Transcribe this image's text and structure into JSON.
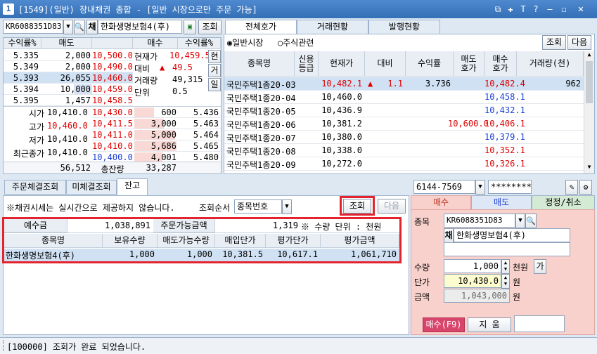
{
  "window": {
    "number": "1",
    "title": "[1549](일반) 장내채권 종합 - [일반 시장으로만 주문 가능]"
  },
  "titlebar_icons": [
    "restore-icon",
    "pin-icon",
    "text-icon",
    "help-icon",
    "minimize-icon",
    "maximize-icon",
    "close-icon"
  ],
  "top_left": {
    "code": "KR6088351D83",
    "type_badge": "채",
    "name": "한화생명보험4(후)",
    "query_button": "조회",
    "orderbook_headers": [
      "수익률%",
      "매도",
      "",
      "매수",
      "수익률%"
    ],
    "ask_rows": [
      {
        "yield": "5.335",
        "qty": "2,000",
        "price": "10,500.0"
      },
      {
        "yield": "5.349",
        "qty": "2,000",
        "price": "10,490.0"
      },
      {
        "yield": "5.393",
        "qty": "26,055",
        "price": "10,460.0"
      },
      {
        "yield": "5.394",
        "qty": "10,000",
        "price": "10,459.0"
      },
      {
        "yield": "5.395",
        "qty": "1,457",
        "price": "10,458.5"
      }
    ],
    "info": {
      "cur_label": "현재가",
      "cur_value": "10,459.5",
      "chg_label": "대비",
      "chg_arrow": "▲",
      "chg_value": "49.5",
      "vol_label": "거래량",
      "vol_value": "49,315",
      "unit_label": "단위",
      "unit_value": "0.5",
      "side_tabs": [
        "현",
        "거",
        "일"
      ]
    },
    "stats": [
      {
        "label": "시가",
        "value": "10,410.0",
        "color": "black"
      },
      {
        "label": "고가",
        "value": "10,460.0",
        "color": "red"
      },
      {
        "label": "저가",
        "value": "10,410.0",
        "color": "black"
      },
      {
        "label": "최근종가",
        "value": "10,410.0",
        "color": "black"
      }
    ],
    "bid_rows": [
      {
        "price": "10,430.0",
        "qty": "600",
        "yield": "5.436"
      },
      {
        "price": "10,411.5",
        "qty": "3,000",
        "yield": "5.463"
      },
      {
        "price": "10,411.0",
        "qty": "5,000",
        "yield": "5.464"
      },
      {
        "price": "10,410.0",
        "qty": "5,686",
        "yield": "5.465"
      },
      {
        "price": "10,400.0",
        "qty": "4,001",
        "yield": "5.480"
      }
    ],
    "totals": {
      "ask_total": "56,512",
      "label": "총잔량",
      "bid_total": "33,287"
    }
  },
  "top_right": {
    "tabs": [
      "전체호가",
      "거래현황",
      "발행현황"
    ],
    "radio_general": "일반시장",
    "radio_stock": "주식관련",
    "query_button": "조회",
    "next_button": "다음",
    "headers": [
      "종목명",
      "신용\n등급",
      "현재가",
      "대비",
      "수익률",
      "매도\n호가",
      "매수\n호가",
      "거래량(천)"
    ],
    "rows": [
      {
        "name": "국민주택1종20-03",
        "price": "10,482.1",
        "arrow": "▲",
        "chg": "1.1",
        "yield": "3.736",
        "ask": "",
        "bid": "10,482.4",
        "bidc": "red",
        "vol": "962",
        "sel": true
      },
      {
        "name": "국민주택1종20-04",
        "price": "10,460.0",
        "arrow": "",
        "chg": "",
        "yield": "",
        "ask": "",
        "bid": "10,458.1",
        "bidc": "blue",
        "vol": "",
        "sel": false
      },
      {
        "name": "국민주택1종20-05",
        "price": "10,436.9",
        "arrow": "",
        "chg": "",
        "yield": "",
        "ask": "",
        "bid": "10,432.1",
        "bidc": "blue",
        "vol": "",
        "sel": false
      },
      {
        "name": "국민주택1종20-06",
        "price": "10,381.2",
        "arrow": "",
        "chg": "",
        "yield": "",
        "ask": "10,600.0",
        "bid": "10,406.1",
        "bidc": "red",
        "vol": "",
        "sel": false
      },
      {
        "name": "국민주택1종20-07",
        "price": "10,380.0",
        "arrow": "",
        "chg": "",
        "yield": "",
        "ask": "",
        "bid": "10,379.1",
        "bidc": "blue",
        "vol": "",
        "sel": false
      },
      {
        "name": "국민주택1종20-08",
        "price": "10,338.0",
        "arrow": "",
        "chg": "",
        "yield": "",
        "ask": "",
        "bid": "10,352.1",
        "bidc": "red",
        "vol": "",
        "sel": false
      },
      {
        "name": "국민주택1종20-09",
        "price": "10,272.0",
        "arrow": "",
        "chg": "",
        "yield": "",
        "ask": "",
        "bid": "10,326.1",
        "bidc": "red",
        "vol": "",
        "sel": false
      }
    ]
  },
  "bottom_left": {
    "tabs": [
      "주문체결조회",
      "미체결조회",
      "잔고"
    ],
    "notice": "※채권시세는 실시간으로 제공하지 않습니다.",
    "sort_label": "조회순서",
    "sort_value": "종목번호",
    "query_button": "조회",
    "next_button": "다음",
    "summary": {
      "deposit_label": "예수금",
      "deposit_value": "1,038,891",
      "avail_label": "주문가능금액",
      "avail_value": "1,319",
      "note": "※ 수량  단위 : 천원"
    },
    "headers": [
      "종목명",
      "보유수량",
      "매도가능수량",
      "매입단가",
      "평가단가",
      "평가금액"
    ],
    "rows": [
      {
        "name": "한화생명보험4(후)",
        "hold": "1,000",
        "sellable": "1,000",
        "buy_price": "10,381.5",
        "eval_price": "10,617.1",
        "eval_amount": "1,061,710"
      }
    ]
  },
  "bottom_right": {
    "account": "6144-7569",
    "password": "*********",
    "tabs": [
      "매수",
      "매도",
      "정정/취소"
    ],
    "code_label": "종목",
    "code": "KR6088351D83",
    "type_badge": "채",
    "name": "한화생명보험4(후)",
    "qty_label": "수량",
    "qty": "1,000",
    "qty_unit": "천원",
    "qty_btn": "가",
    "price_label": "단가",
    "price": "10,430.0",
    "price_unit": "원",
    "amount_label": "금액",
    "amount": "1,043,000",
    "amount_unit": "원",
    "buy_button": "매수(F9)",
    "clear_button": "지 움"
  },
  "status": "[100000] 조회가 완료 되었습니다."
}
